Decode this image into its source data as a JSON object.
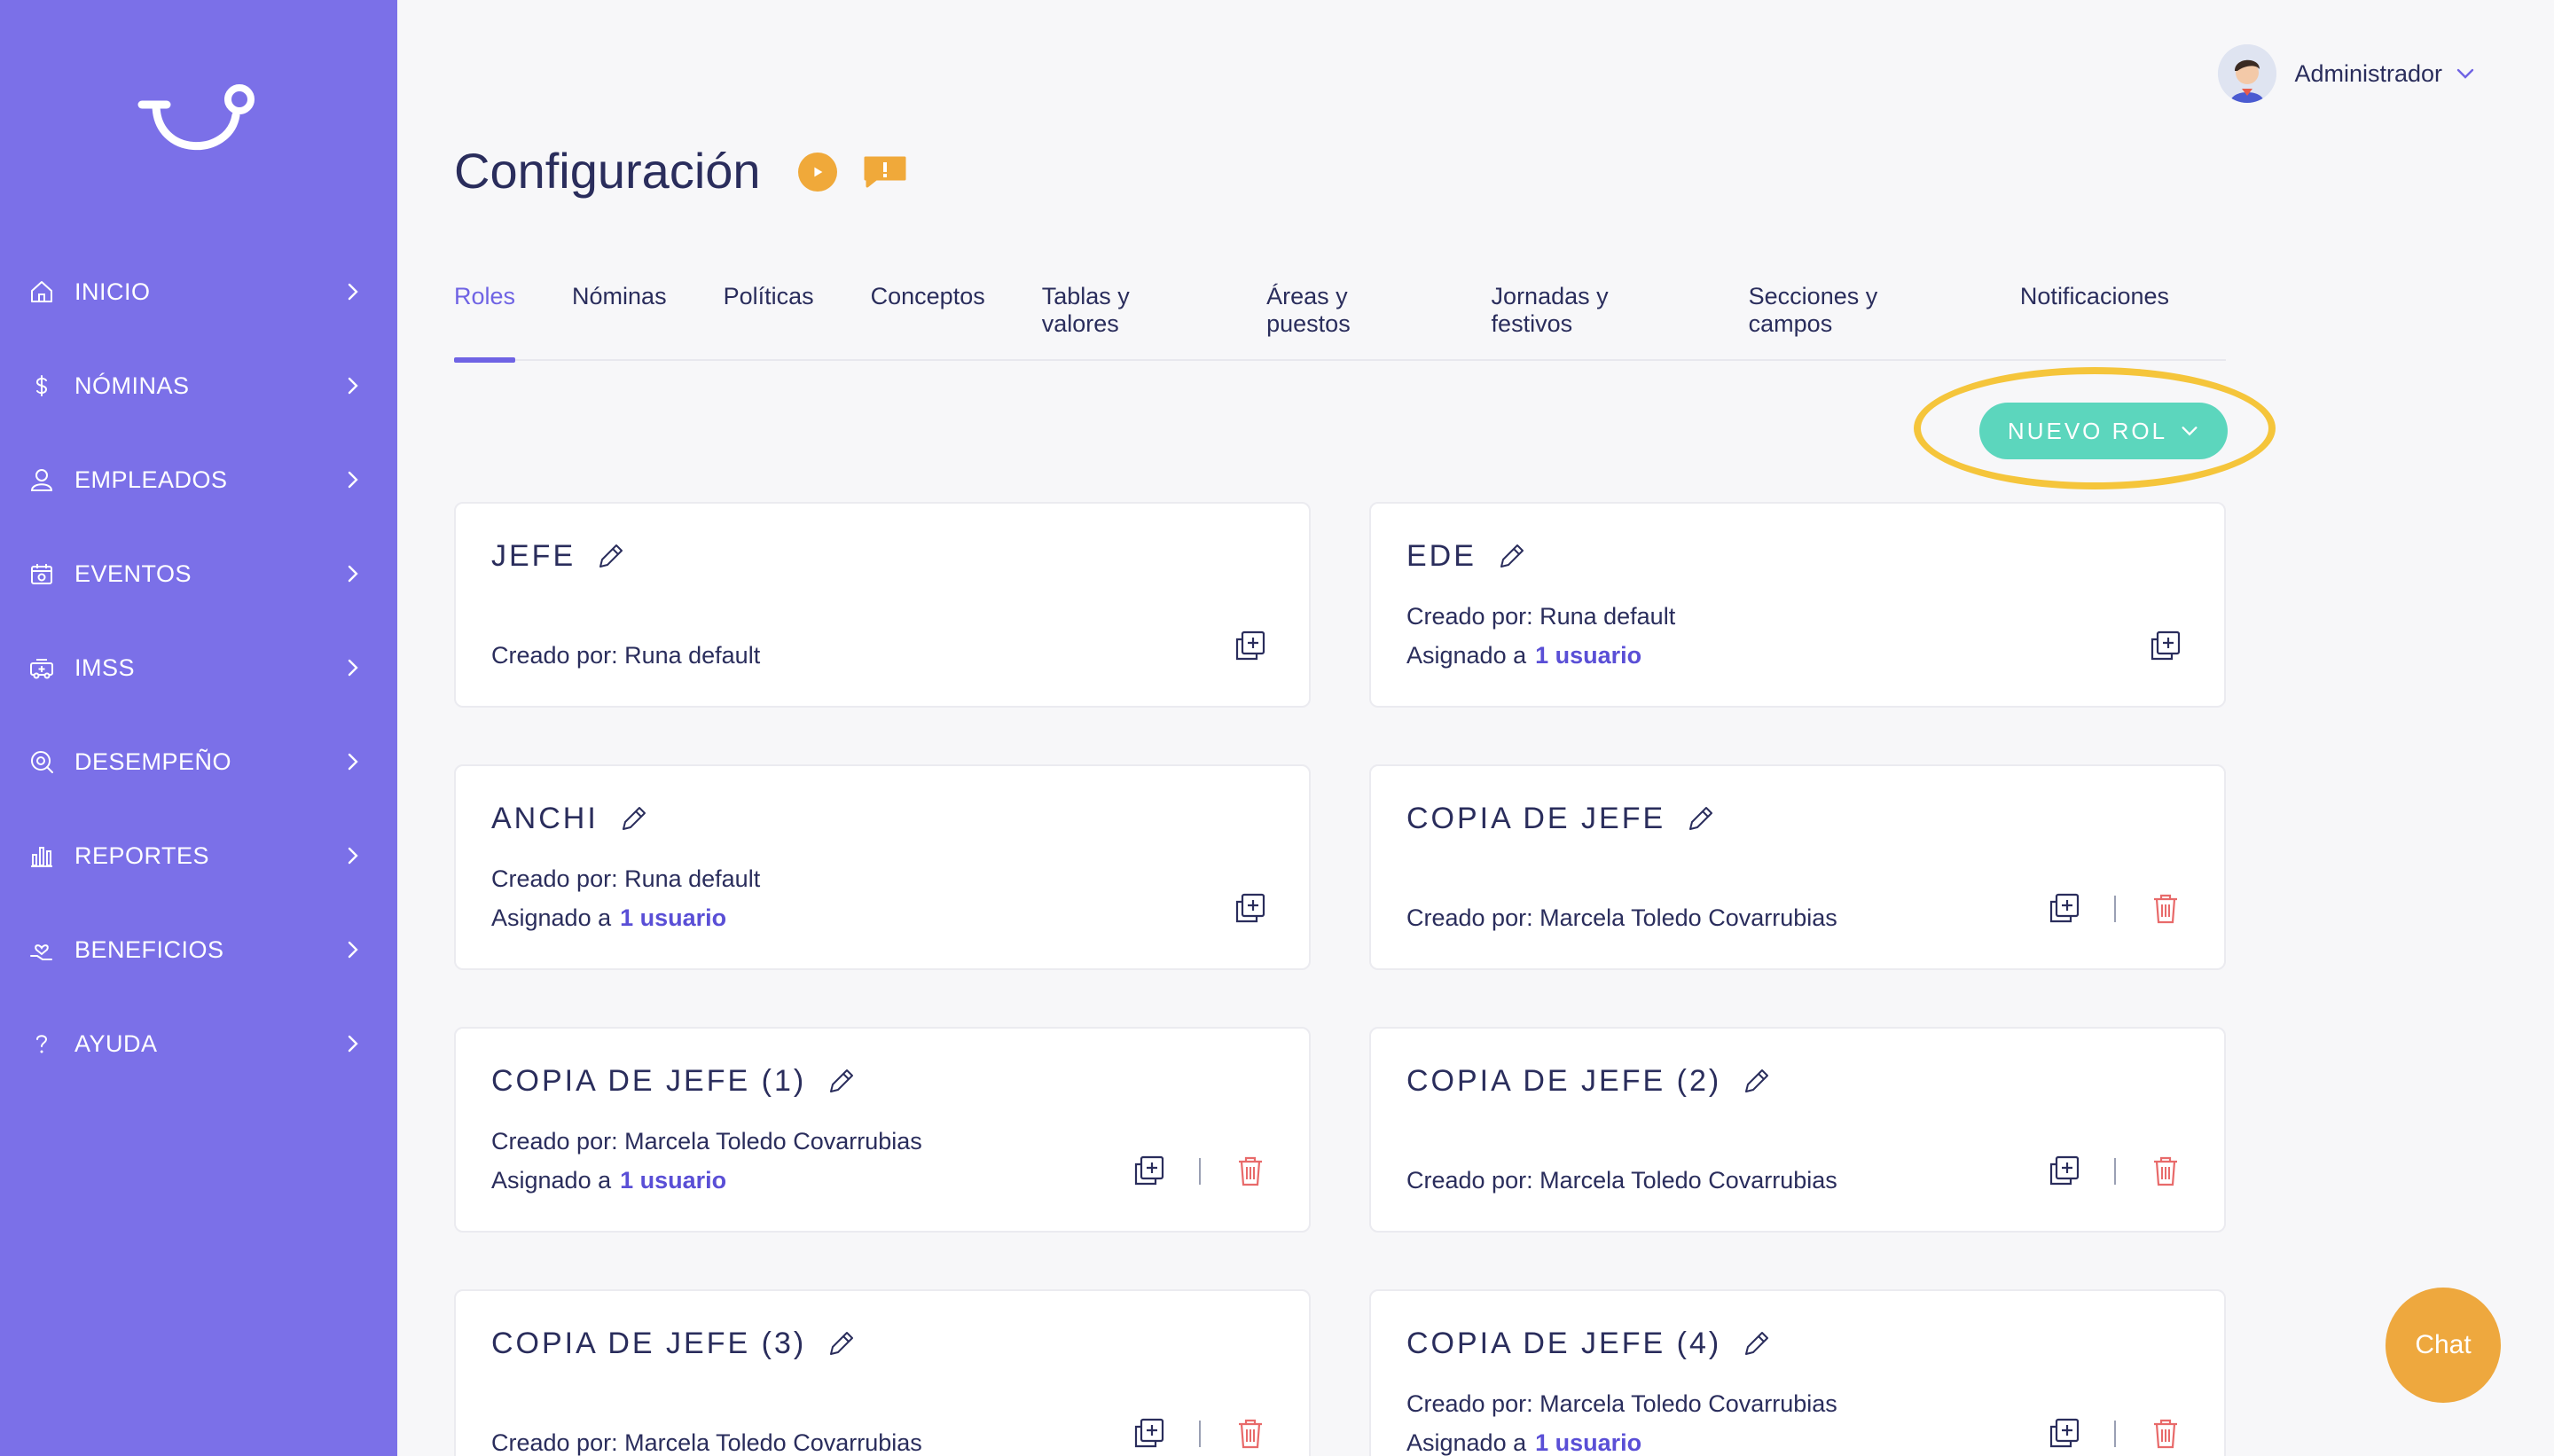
{
  "sidebar": {
    "items": [
      {
        "label": "INICIO",
        "icon": "home-icon"
      },
      {
        "label": "NÓMINAS",
        "icon": "dollar-icon"
      },
      {
        "label": "EMPLEADOS",
        "icon": "user-icon"
      },
      {
        "label": "EVENTOS",
        "icon": "calendar-icon"
      },
      {
        "label": "IMSS",
        "icon": "ambulance-icon"
      },
      {
        "label": "DESEMPEÑO",
        "icon": "performance-icon"
      },
      {
        "label": "REPORTES",
        "icon": "bar-chart-icon"
      },
      {
        "label": "BENEFICIOS",
        "icon": "hand-heart-icon"
      },
      {
        "label": "AYUDA",
        "icon": "question-icon"
      }
    ]
  },
  "header": {
    "user_name": "Administrador",
    "page_title": "Configuración"
  },
  "tabs": [
    {
      "label": "Roles",
      "active": true
    },
    {
      "label": "Nóminas"
    },
    {
      "label": "Políticas"
    },
    {
      "label": "Conceptos"
    },
    {
      "label": "Tablas y valores"
    },
    {
      "label": "Áreas y puestos"
    },
    {
      "label": "Jornadas y festivos"
    },
    {
      "label": "Secciones y campos"
    },
    {
      "label": "Notificaciones"
    }
  ],
  "new_role_button": "NUEVO ROL",
  "cards": [
    {
      "title": "JEFE",
      "created_by": "Creado por: Runa default",
      "assigned_prefix": "",
      "assigned_link": "",
      "deletable": false
    },
    {
      "title": "EDE",
      "created_by": "Creado por: Runa default",
      "assigned_prefix": "Asignado a",
      "assigned_link": "1 usuario",
      "deletable": false
    },
    {
      "title": "ANCHI",
      "created_by": "Creado por: Runa default",
      "assigned_prefix": "Asignado a",
      "assigned_link": "1 usuario",
      "deletable": false
    },
    {
      "title": "COPIA DE JEFE",
      "created_by": "Creado por: Marcela Toledo Covarrubias",
      "assigned_prefix": "",
      "assigned_link": "",
      "deletable": true
    },
    {
      "title": "COPIA DE JEFE (1)",
      "created_by": "Creado por: Marcela Toledo Covarrubias",
      "assigned_prefix": "Asignado a",
      "assigned_link": "1 usuario",
      "deletable": true
    },
    {
      "title": "COPIA DE JEFE (2)",
      "created_by": "Creado por: Marcela Toledo Covarrubias",
      "assigned_prefix": "",
      "assigned_link": "",
      "deletable": true
    },
    {
      "title": "COPIA DE JEFE (3)",
      "created_by": "Creado por: Marcela Toledo Covarrubias",
      "assigned_prefix": "",
      "assigned_link": "",
      "deletable": true
    },
    {
      "title": "COPIA DE JEFE (4)",
      "created_by": "Creado por: Marcela Toledo Covarrubias",
      "assigned_prefix": "Asignado a",
      "assigned_link": "1 usuario",
      "deletable": true
    }
  ],
  "chat_label": "Chat",
  "colors": {
    "sidebar": "#7b70e8",
    "accent": "#6f63e4",
    "button": "#5cd6bd",
    "highlight": "#f5c53b",
    "chat": "#eea83e",
    "trash": "#e86a6a"
  }
}
